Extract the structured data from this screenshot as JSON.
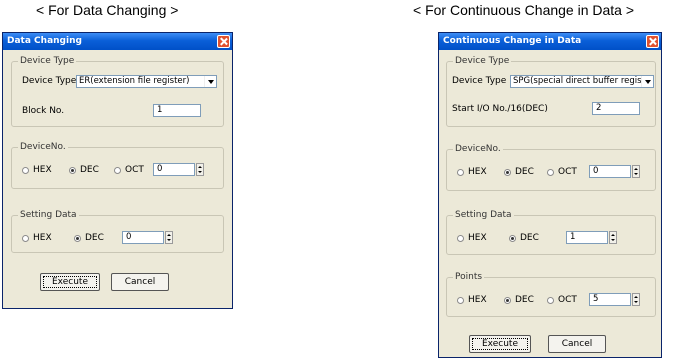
{
  "captions": {
    "left": "< For Data Changing >",
    "right": "< For Continuous Change in Data >"
  },
  "dialog1": {
    "title": "Data Changing",
    "device_type_group": "Device Type",
    "device_type_label": "Device Type",
    "device_type_value": "ER(extension file register)",
    "block_label": "Block No.",
    "block_value": "1",
    "device_no_group": "DeviceNo.",
    "radio_hex": "HEX",
    "radio_dec": "DEC",
    "radio_oct": "OCT",
    "device_no_value": "0",
    "setting_group": "Setting Data",
    "setting_value": "0",
    "execute": "Execute",
    "cancel": "Cancel"
  },
  "dialog2": {
    "title": "Continuous Change in Data",
    "device_type_group": "Device Type",
    "device_type_label": "Device Type",
    "device_type_value": "SPG(special direct buffer register)",
    "start_io_label": "Start I/O No./16(DEC)",
    "start_io_value": "2",
    "device_no_group": "DeviceNo.",
    "radio_hex": "HEX",
    "radio_dec": "DEC",
    "radio_oct": "OCT",
    "device_no_value": "0",
    "setting_group": "Setting Data",
    "setting_value": "1",
    "points_group": "Points",
    "points_value": "5",
    "execute": "Execute",
    "cancel": "Cancel"
  },
  "icons": [
    "close-icon",
    "dropdown-arrow-icon",
    "spin-icon"
  ]
}
